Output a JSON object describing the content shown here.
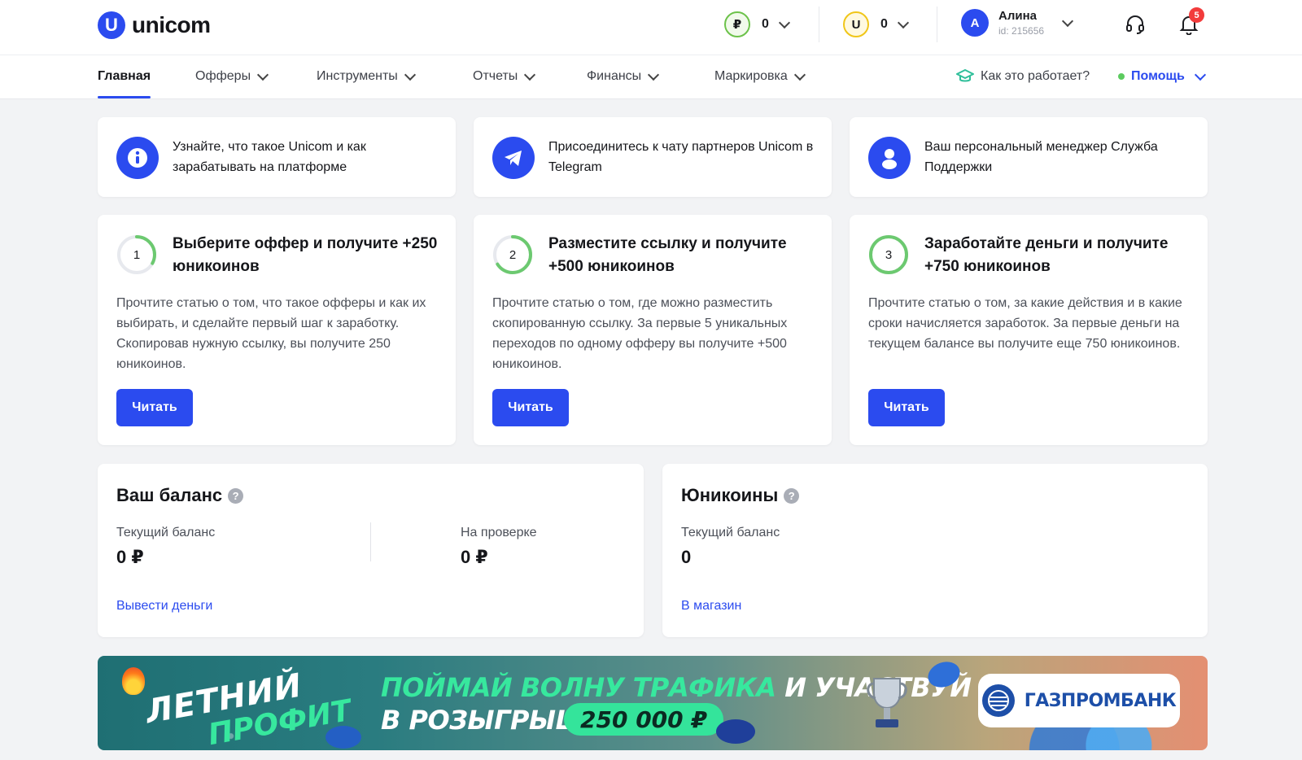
{
  "header": {
    "logo_mark": "U",
    "logo_text": "unicom",
    "wallets": [
      {
        "symbol": "₽",
        "value": "0",
        "icon": "ruble-coin-icon"
      },
      {
        "symbol": "U",
        "value": "0",
        "icon": "unicoin-icon"
      }
    ],
    "user": {
      "initial": "А",
      "name": "Алина",
      "id": "id: 215656"
    },
    "notifications_count": "5"
  },
  "nav": {
    "items": [
      {
        "label": "Главная",
        "active": true,
        "has_dropdown": false
      },
      {
        "label": "Офферы",
        "active": false,
        "has_dropdown": true
      },
      {
        "label": "Инструменты",
        "active": false,
        "has_dropdown": true
      },
      {
        "label": "Отчеты",
        "active": false,
        "has_dropdown": true
      },
      {
        "label": "Финансы",
        "active": false,
        "has_dropdown": true
      },
      {
        "label": "Маркировка",
        "active": false,
        "has_dropdown": true
      }
    ],
    "how_it_works": "Как это работает?",
    "help": "Помощь"
  },
  "info_cards": [
    {
      "icon": "info-icon",
      "text": "Узнайте, что такое Unicom и как зарабатывать на платформе"
    },
    {
      "icon": "telegram-icon",
      "text": "Присоединитесь к чату партнеров Unicom в Telegram"
    },
    {
      "icon": "manager-icon",
      "text": "Ваш персональный менеджер Служба Поддержки"
    }
  ],
  "steps": [
    {
      "num": "1",
      "title": "Выберите оффер и получите +250 юникоинов",
      "desc": "Прочтите статью о том, что такое офферы и как их выбирать, и сделайте первый шаг к заработку. Скопировав нужную ссылку, вы получите 250 юникоинов.",
      "button": "Читать",
      "progress": 0.33
    },
    {
      "num": "2",
      "title": "Разместите ссылку и получите +500 юникоинов",
      "desc": "Прочтите статью о том, где можно разместить скопированную ссылку. За первые 5 уникальных переходов по одному офферу вы получите +500 юникоинов.",
      "button": "Читать",
      "progress": 0.66
    },
    {
      "num": "3",
      "title": "Заработайте деньги и получите +750 юникоинов",
      "desc": "Прочтите статью о том, за какие действия и в какие сроки начисляется заработок. За первые деньги на текущем балансе вы получите еще 750 юникоинов.",
      "button": "Читать",
      "progress": 1.0
    }
  ],
  "balance": {
    "title": "Ваш баланс",
    "current_label": "Текущий баланс",
    "current_value": "0 ₽",
    "pending_label": "На проверке",
    "pending_value": "0 ₽",
    "link": "Вывести деньги"
  },
  "unicoins": {
    "title": "Юникоины",
    "current_label": "Текущий баланс",
    "current_value": "0",
    "link": "В магазин"
  },
  "banner": {
    "letny": "ЛЕТНИЙ",
    "profit": "ПРОФИТ",
    "line1_green": "ПОЙМАЙ ВОЛНУ ТРАФИКА",
    "line1_white": "И УЧАСТВУЙ",
    "line2": "В РОЗЫГРЫШЕ",
    "prize": "250 000 ₽",
    "sponsor": "ГАЗПРОМБАНК"
  },
  "colors": {
    "accent": "#2b4bef",
    "ring": "#6cc970",
    "banner_green": "#37e89e"
  }
}
